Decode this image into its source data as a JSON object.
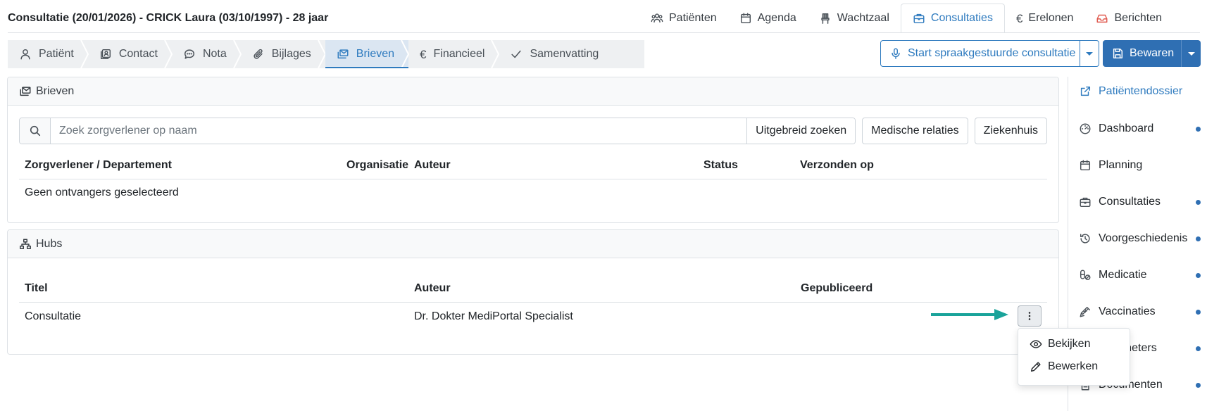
{
  "header": {
    "title": "Consultatie (20/01/2026) - CRICK Laura (03/10/1997) - 28 jaar",
    "nav": [
      {
        "label": "Patiënten",
        "icon": "users-icon"
      },
      {
        "label": "Agenda",
        "icon": "calendar-icon"
      },
      {
        "label": "Wachtzaal",
        "icon": "chair-icon"
      },
      {
        "label": "Consultaties",
        "icon": "briefcase-icon",
        "active": true
      },
      {
        "label": "Erelonen",
        "icon": "euro-icon"
      },
      {
        "label": "Berichten",
        "icon": "inbox-icon"
      }
    ]
  },
  "subtabs": [
    {
      "label": "Patiënt",
      "icon": "person-icon"
    },
    {
      "label": "Contact",
      "icon": "contact-card-icon"
    },
    {
      "label": "Nota",
      "icon": "chat-icon"
    },
    {
      "label": "Bijlages",
      "icon": "paperclip-icon"
    },
    {
      "label": "Brieven",
      "icon": "letters-icon",
      "active": true
    },
    {
      "label": "Financieel",
      "icon": "euro-icon"
    },
    {
      "label": "Samenvatting",
      "icon": "check-icon"
    }
  ],
  "actions": {
    "voice_label": "Start spraakgestuurde consultatie",
    "save_label": "Bewaren"
  },
  "brieven": {
    "title": "Brieven",
    "search": {
      "placeholder": "Zoek zorgverlener op naam",
      "value": ""
    },
    "buttons": {
      "advanced": "Uitgebreid zoeken",
      "medical": "Medische relaties",
      "hospital": "Ziekenhuis"
    },
    "columns": [
      "Zorgverlener / Departement",
      "Organisatie",
      "Auteur",
      "Status",
      "Verzonden op"
    ],
    "empty_text": "Geen ontvangers geselecteerd"
  },
  "hubs": {
    "title": "Hubs",
    "columns": [
      "Titel",
      "Auteur",
      "Gepubliceerd"
    ],
    "rows": [
      {
        "titel": "Consultatie",
        "auteur": "Dr. Dokter MediPortal Specialist",
        "gepubliceerd": ""
      }
    ],
    "menu": [
      {
        "label": "Bekijken",
        "icon": "eye-icon"
      },
      {
        "label": "Bewerken",
        "icon": "pencil-icon"
      }
    ]
  },
  "sidebar": {
    "items": [
      {
        "label": "Patiëntendossier",
        "icon": "external-link-icon",
        "dot": false
      },
      {
        "label": "Dashboard",
        "icon": "gauge-icon",
        "dot": true
      },
      {
        "label": "Planning",
        "icon": "calendar-icon",
        "dot": false
      },
      {
        "label": "Consultaties",
        "icon": "briefcase-icon",
        "dot": true
      },
      {
        "label": "Voorgeschiedenis",
        "icon": "history-icon",
        "dot": true
      },
      {
        "label": "Medicatie",
        "icon": "pills-icon",
        "dot": true
      },
      {
        "label": "Vaccinaties",
        "icon": "syringe-icon",
        "dot": true
      },
      {
        "label": "Parameters",
        "icon": "parameters-icon",
        "dot": true
      },
      {
        "label": "Documenten",
        "icon": "document-icon",
        "dot": true
      }
    ]
  },
  "colors": {
    "primary": "#2f7bbf",
    "save_button": "#2f6fb3",
    "annotation_arrow": "#1aa39a",
    "inbox_icon": "#e05a4f"
  }
}
